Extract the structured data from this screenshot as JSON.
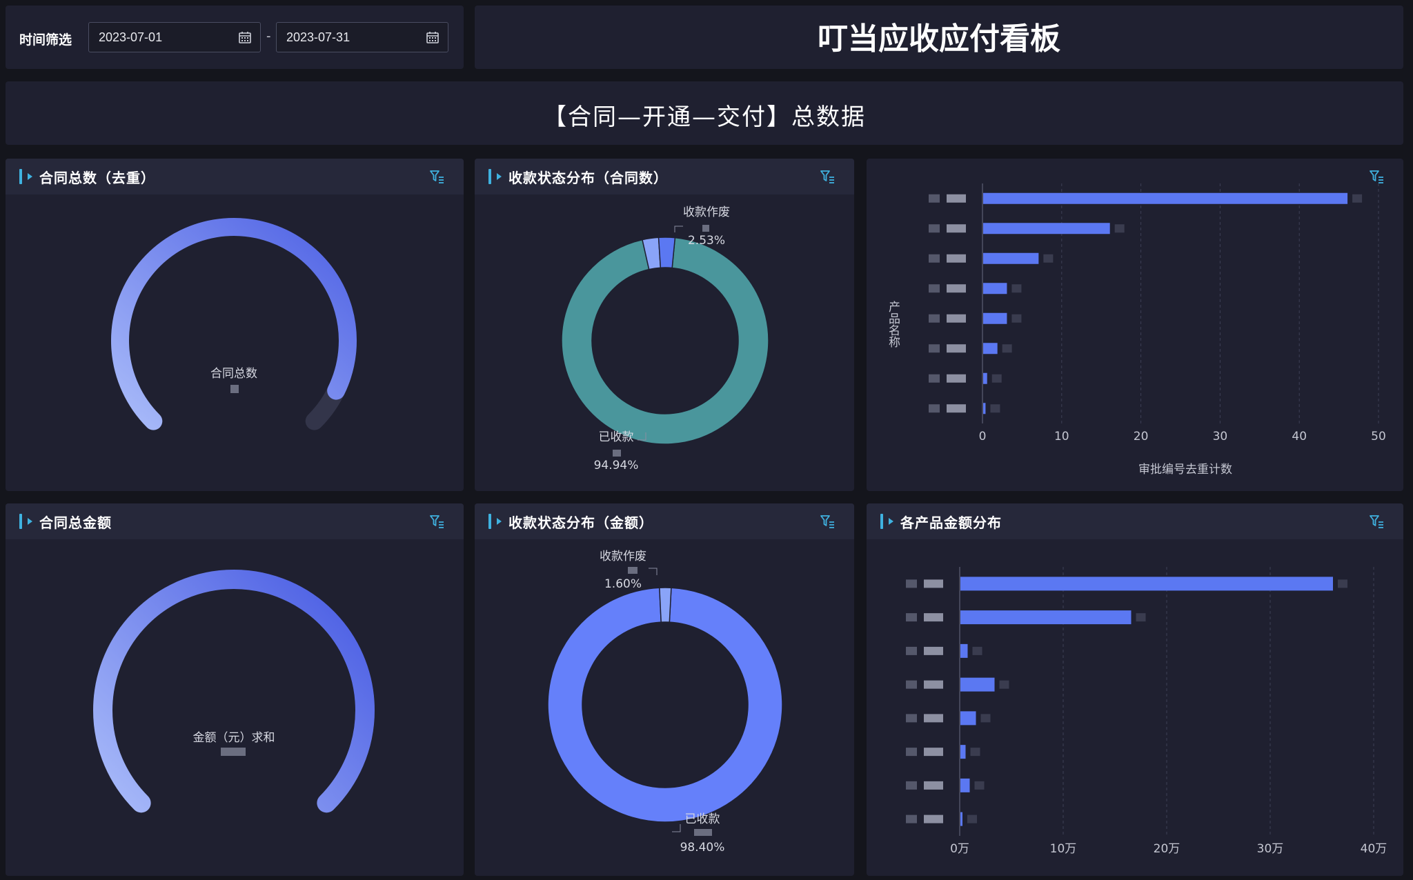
{
  "filter": {
    "label": "时间筛选",
    "start_date": "2023-07-01",
    "end_date": "2023-07-31",
    "separator": "-"
  },
  "board_title": "叮当应收应付看板",
  "section_title": "【合同—开通—交付】总数据",
  "panels": {
    "contract_count": {
      "title": "合同总数（去重）",
      "center_label": "合同总数",
      "fill_fraction": 0.93
    },
    "status_count": {
      "title": "收款状态分布（合同数）"
    },
    "product_count": {
      "title": ""
    },
    "contract_amount": {
      "title": "合同总金额",
      "center_label": "金额（元）求和",
      "fill_fraction": 1.0
    },
    "status_amount": {
      "title": "收款状态分布（金额）"
    },
    "product_amount": {
      "title": "各产品金额分布"
    }
  },
  "colors": {
    "accent": "#3fb2e0",
    "bar": "#5b78f2",
    "teal": "#4a969c",
    "gauge_start": "#a9bbf9",
    "gauge_end": "#4e61e4",
    "slice_light": "#8aa4f8"
  },
  "chart_data": [
    {
      "type": "pie",
      "variant": "donut",
      "slices": [
        {
          "label": "已收款",
          "percent": 94.94,
          "color": "#4a969c"
        },
        {
          "label": "收款作废",
          "percent": 2.53,
          "color": "#8aa4f8"
        },
        {
          "label": "",
          "percent": 2.53,
          "color": "#5b78f2"
        }
      ],
      "labels": {
        "void": {
          "name": "收款作废",
          "pct": "2.53%"
        },
        "received": {
          "name": "已收款",
          "pct": "94.94%"
        }
      }
    },
    {
      "type": "bar",
      "orientation": "horizontal",
      "ylabel": "产品名称",
      "xlabel": "审批编号去重计数",
      "xlim": [
        0,
        50
      ],
      "xticks": [
        "0",
        "10",
        "20",
        "30",
        "40",
        "50"
      ],
      "values": [
        46,
        16,
        7,
        3,
        3,
        1.8,
        0.5,
        0.3
      ],
      "grid": "vertical-dashed"
    },
    {
      "type": "pie",
      "variant": "donut",
      "slices": [
        {
          "label": "已收款",
          "percent": 98.4,
          "color": "#6580fa"
        },
        {
          "label": "收款作废",
          "percent": 1.6,
          "color": "#8aa4f8"
        }
      ],
      "labels": {
        "void": {
          "name": "收款作废",
          "pct": "1.60%"
        },
        "received": {
          "name": "已收款",
          "pct": "98.40%"
        }
      }
    },
    {
      "type": "bar",
      "orientation": "horizontal",
      "xlim": [
        0,
        400000
      ],
      "xticks": [
        "0万",
        "10万",
        "20万",
        "30万",
        "40万"
      ],
      "values": [
        360000,
        165000,
        7000,
        33000,
        15000,
        5000,
        9000,
        2000
      ],
      "grid": "vertical-dashed"
    }
  ]
}
